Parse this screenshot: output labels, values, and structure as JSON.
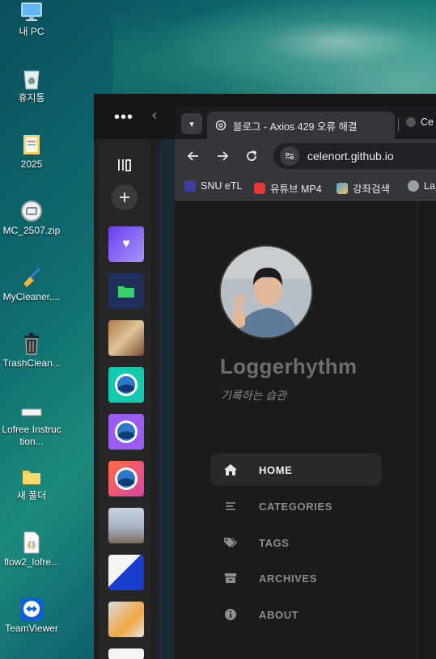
{
  "desktop": {
    "icons": [
      {
        "label": "내 PC",
        "icon": "computer-icon"
      },
      {
        "label": "휴지통",
        "icon": "recycle-bin-icon"
      },
      {
        "label": "2025",
        "icon": "folder-icon"
      },
      {
        "label": "MC_2507.zip",
        "icon": "zip-icon"
      },
      {
        "label": "MyCleaner....",
        "icon": "broom-icon"
      },
      {
        "label": "TrashClean...",
        "icon": "trash-icon"
      },
      {
        "label": "Lofree Instruction...",
        "icon": "document-icon"
      },
      {
        "label": "새 폴더",
        "icon": "folder-icon"
      },
      {
        "label": "flow2_lofre...",
        "icon": "json-file-icon"
      },
      {
        "label": "TeamViewer",
        "icon": "teamviewer-icon"
      }
    ]
  },
  "browser": {
    "menu_label": "•••",
    "back_label": "‹",
    "sidebar": {
      "library_icon": "library-icon",
      "add_icon": "plus-icon"
    },
    "tabs": [
      {
        "title": "블로그 - Axios 429 오류 해결",
        "active": true
      },
      {
        "title": "Ce",
        "active": false
      }
    ],
    "toolbar": {
      "url": "celenort.github.io"
    },
    "bookmarks": [
      {
        "label": "SNU eTL",
        "color": "#3b3f9e"
      },
      {
        "label": "유튜브 MP4",
        "color": "#e53935"
      },
      {
        "label": "강좌검색",
        "color": "#4fa3e0"
      },
      {
        "label": "La",
        "color": "#9aa0a6"
      }
    ]
  },
  "site": {
    "title": "Loggerhythm",
    "subtitle": "기록하는 습관",
    "nav": [
      {
        "label": "HOME",
        "icon": "home-icon",
        "active": true
      },
      {
        "label": "CATEGORIES",
        "icon": "list-icon",
        "active": false
      },
      {
        "label": "TAGS",
        "icon": "tags-icon",
        "active": false
      },
      {
        "label": "ARCHIVES",
        "icon": "archive-icon",
        "active": false
      },
      {
        "label": "ABOUT",
        "icon": "info-icon",
        "active": false
      }
    ]
  }
}
